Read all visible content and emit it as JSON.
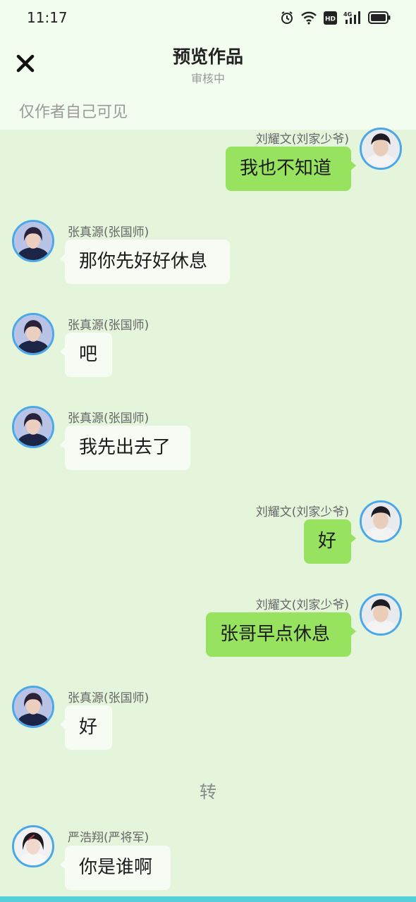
{
  "status_bar": {
    "time": "11:17",
    "network": "4G",
    "hd_label": "HD",
    "icons": [
      "alarm-icon",
      "wifi-icon",
      "hd-icon",
      "signal-4g-icon",
      "battery-icon"
    ]
  },
  "header": {
    "title": "预览作品",
    "subtitle": "审核中",
    "visibility_note": "仅作者自己可见",
    "close_icon": "close-icon"
  },
  "messages": [
    {
      "side": "right",
      "name": "刘耀文(刘家少爷)",
      "text": "我也不知道"
    },
    {
      "side": "left",
      "name": "张真源(张国师)",
      "text": "那你先好好休息"
    },
    {
      "side": "left",
      "name": "张真源(张国师)",
      "text": "吧"
    },
    {
      "side": "left",
      "name": "张真源(张国师)",
      "text": "我先出去了"
    },
    {
      "side": "right",
      "name": "刘耀文(刘家少爷)",
      "text": "好"
    },
    {
      "side": "right",
      "name": "刘耀文(刘家少爷)",
      "text": "张哥早点休息"
    },
    {
      "side": "left",
      "name": "张真源(张国师)",
      "text": "好"
    },
    {
      "side": "left",
      "name": "严浩翔(严将军)",
      "text": "你是谁啊"
    }
  ],
  "divider": "转",
  "colors": {
    "background": "#e4f5dc",
    "header": "#f2fcef",
    "bubble_right": "#97e25f",
    "bubble_left": "#f6fcf3",
    "avatar_border": "#4aa8e8",
    "bottom_bar": "#56d0d8"
  }
}
